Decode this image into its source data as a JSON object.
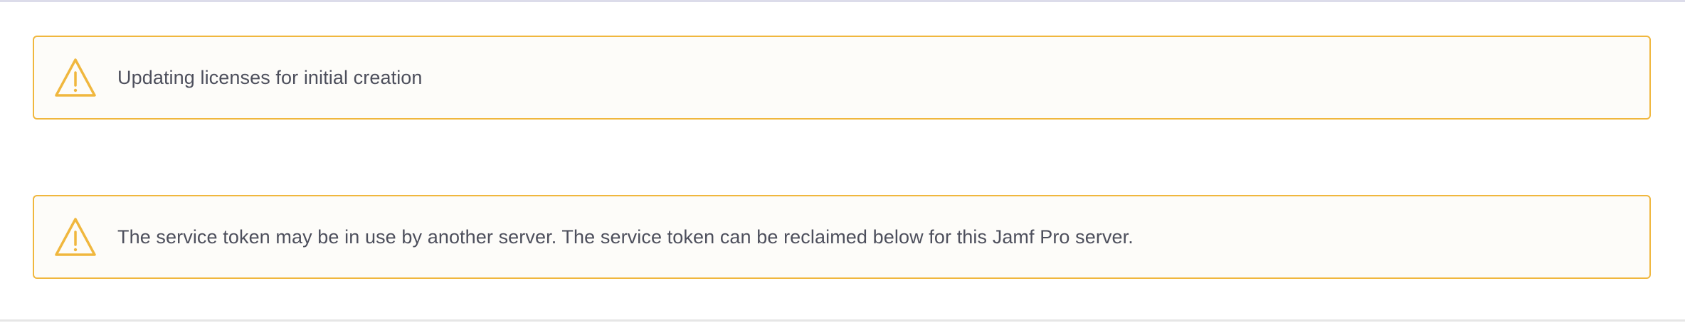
{
  "alerts": [
    {
      "icon": "warning-icon",
      "message": "Updating licenses for initial creation"
    },
    {
      "icon": "warning-icon",
      "message": "The service token may be in use by another server. The service token can be reclaimed below for this Jamf Pro server."
    }
  ],
  "colors": {
    "warning_border": "#f0b73e",
    "warning_icon": "#f0b73e",
    "alert_background": "#fdfcf9",
    "text": "#4d4f5c"
  }
}
